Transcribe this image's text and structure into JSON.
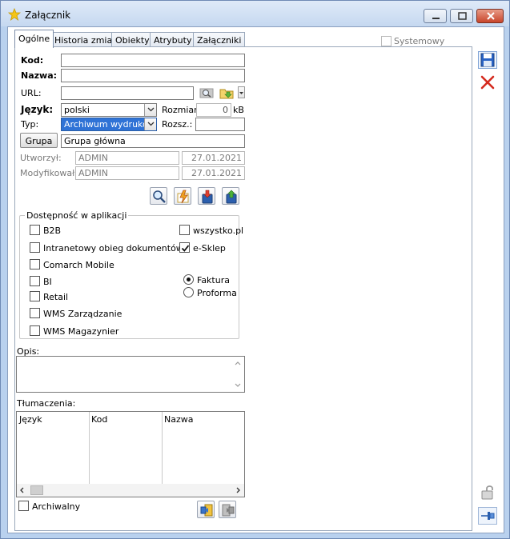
{
  "window": {
    "title": "Załącznik"
  },
  "tabs": [
    {
      "label": "Ogólne"
    },
    {
      "label": "Historia zmian"
    },
    {
      "label": "Obiekty"
    },
    {
      "label": "Atrybuty"
    },
    {
      "label": "Załączniki"
    }
  ],
  "systemowy": {
    "label": "Systemowy"
  },
  "form": {
    "kod_label": "Kod:",
    "kod_value": "",
    "nazwa_label": "Nazwa:",
    "nazwa_value": "",
    "url_label": "URL:",
    "url_value": "",
    "jezyk_label": "Język:",
    "jezyk_value": "polski",
    "rozmiar_label": "Rozmiar:",
    "rozmiar_value": "0",
    "rozmiar_unit": "kB",
    "typ_label": "Typ:",
    "typ_value": "Archiwum wydruków",
    "rozsz_label": "Rozsz.:",
    "rozsz_value": "",
    "grupa_button": "Grupa",
    "grupa_value": "Grupa główna",
    "utworzyl_label": "Utworzył:",
    "utworzyl_user": "ADMIN",
    "utworzyl_date": "27.01.2021",
    "modyfikowal_label": "Modyfikował:",
    "modyfikowal_user": "ADMIN",
    "modyfikowal_date": "27.01.2021"
  },
  "availability": {
    "title": "Dostępność w aplikacji",
    "items": [
      {
        "label": "B2B",
        "checked": false
      },
      {
        "label": "Intranetowy obieg dokumentów",
        "checked": false
      },
      {
        "label": "Comarch Mobile",
        "checked": false
      },
      {
        "label": "BI",
        "checked": false
      },
      {
        "label": "Retail",
        "checked": false
      },
      {
        "label": "WMS Zarządzanie",
        "checked": false
      },
      {
        "label": "WMS Magazynier",
        "checked": false
      },
      {
        "label": "wszystko.pl",
        "checked": false
      },
      {
        "label": "e-Sklep",
        "checked": true
      }
    ],
    "radios": [
      {
        "label": "Faktura",
        "checked": true
      },
      {
        "label": "Proforma",
        "checked": false
      }
    ]
  },
  "opis": {
    "label": "Opis:",
    "value": ""
  },
  "tlumaczenia": {
    "label": "Tłumaczenia:",
    "columns": [
      "Język",
      "Kod",
      "Nazwa"
    ]
  },
  "archiwalny": {
    "label": "Archiwalny",
    "checked": false
  },
  "colors": {
    "selection": "#2f73d6",
    "save": "#2a63c4",
    "cancel": "#d42a1e"
  }
}
